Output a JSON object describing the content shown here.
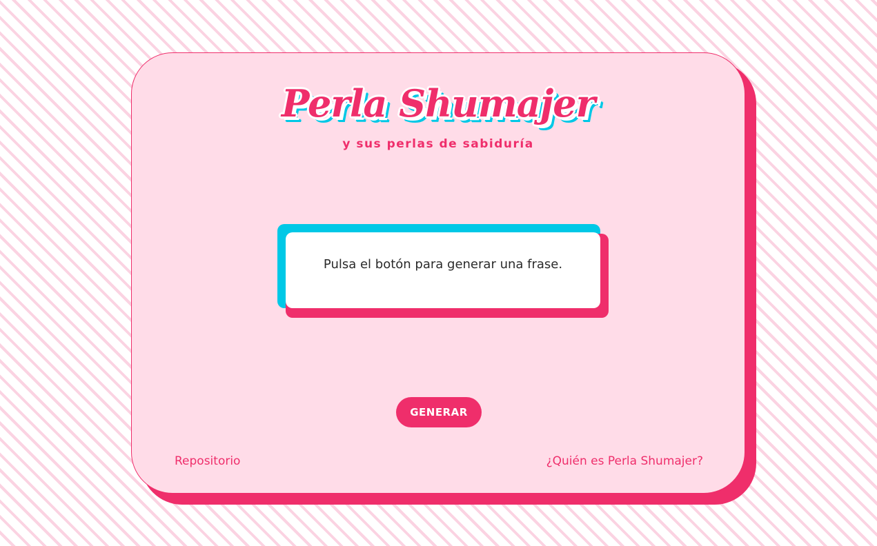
{
  "header": {
    "title": "Perla Shumajer",
    "subtitle": "y sus perlas de sabiduría"
  },
  "quote": {
    "text": "Pulsa el botón para generar una frase."
  },
  "actions": {
    "generate_label": "GENERAR"
  },
  "footer": {
    "repo_label": "Repositorio",
    "about_label": "¿Quién es Perla Shumajer?"
  },
  "colors": {
    "accent": "#ef2e6b",
    "accent_secondary": "#00c8e6",
    "card_background": "#ffdce8",
    "stripe": "#fbd3e2"
  }
}
